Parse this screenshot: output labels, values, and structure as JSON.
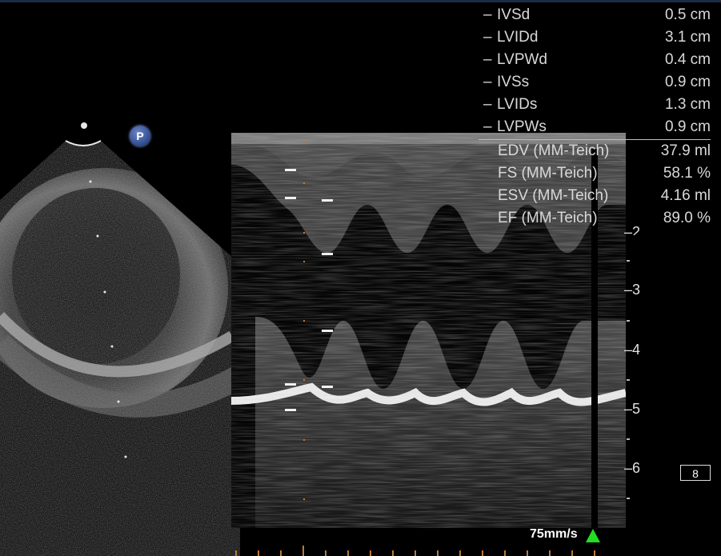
{
  "measurements": [
    {
      "label": "IVSd",
      "value": "0.5 cm"
    },
    {
      "label": "LVIDd",
      "value": "3.1 cm"
    },
    {
      "label": "LVPWd",
      "value": "0.4 cm"
    },
    {
      "label": "IVSs",
      "value": "0.9 cm"
    },
    {
      "label": "LVIDs",
      "value": "1.3 cm"
    },
    {
      "label": "LVPWs",
      "value": "0.9 cm"
    }
  ],
  "calculations": [
    {
      "label": "EDV (MM-Teich)",
      "value": "37.9 ml"
    },
    {
      "label": "FS (MM-Teich)",
      "value": "58.1 %"
    },
    {
      "label": "ESV (MM-Teich)",
      "value": "4.16 ml"
    },
    {
      "label": "EF (MM-Teich)",
      "value": "89.0 %"
    }
  ],
  "depth_scale": {
    "labels": [
      "2",
      "3",
      "4",
      "5",
      "6"
    ]
  },
  "sweep_speed": "75mm/s",
  "zone_indicator": "8",
  "probe_marker": "P",
  "colors": {
    "marker_green": "#22dd22",
    "text": "#d8d8d8",
    "topbar": "#1c2b44"
  }
}
